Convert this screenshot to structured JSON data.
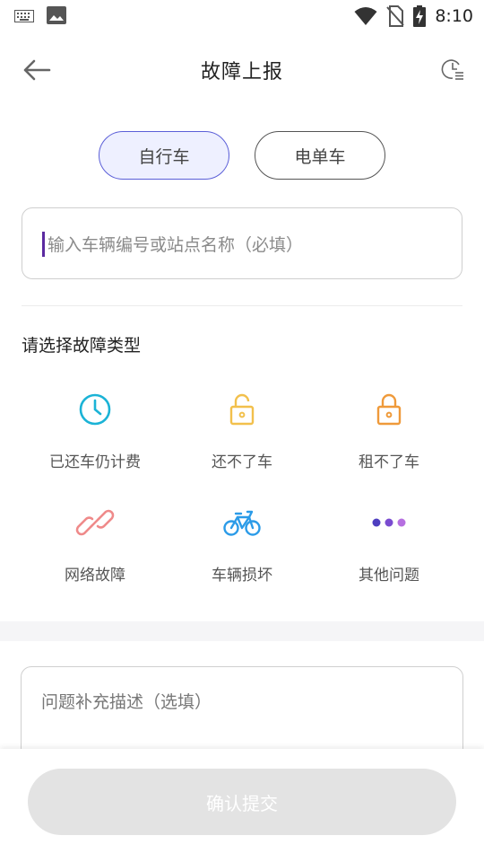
{
  "status_bar": {
    "time": "8:10"
  },
  "header": {
    "title": "故障上报"
  },
  "vehicle_tabs": {
    "bicycle": "自行车",
    "ebike": "电单车"
  },
  "vehicle_input": {
    "placeholder": "输入车辆编号或站点名称（必填）",
    "value": ""
  },
  "fault_section": {
    "title": "请选择故障类型"
  },
  "fault_types": [
    {
      "label": "已还车仍计费",
      "icon": "clock-icon",
      "color": "#1bb3d6"
    },
    {
      "label": "还不了车",
      "icon": "unlock-icon",
      "color": "#f2c04c"
    },
    {
      "label": "租不了车",
      "icon": "lock-icon",
      "color": "#ef9a3a"
    },
    {
      "label": "网络故障",
      "icon": "link-icon",
      "color": "#ef8a8a"
    },
    {
      "label": "车辆损坏",
      "icon": "bicycle-icon",
      "color": "#2b9be8"
    },
    {
      "label": "其他问题",
      "icon": "more-dots-icon",
      "color": "#7a4bd0"
    }
  ],
  "description": {
    "placeholder": "问题补充描述（选填）",
    "value": ""
  },
  "submit": {
    "label": "确认提交"
  },
  "colors": {
    "accent": "#5b5fd8",
    "accent_bg": "#eef0ff",
    "submit_disabled": "#e3e3e3"
  }
}
